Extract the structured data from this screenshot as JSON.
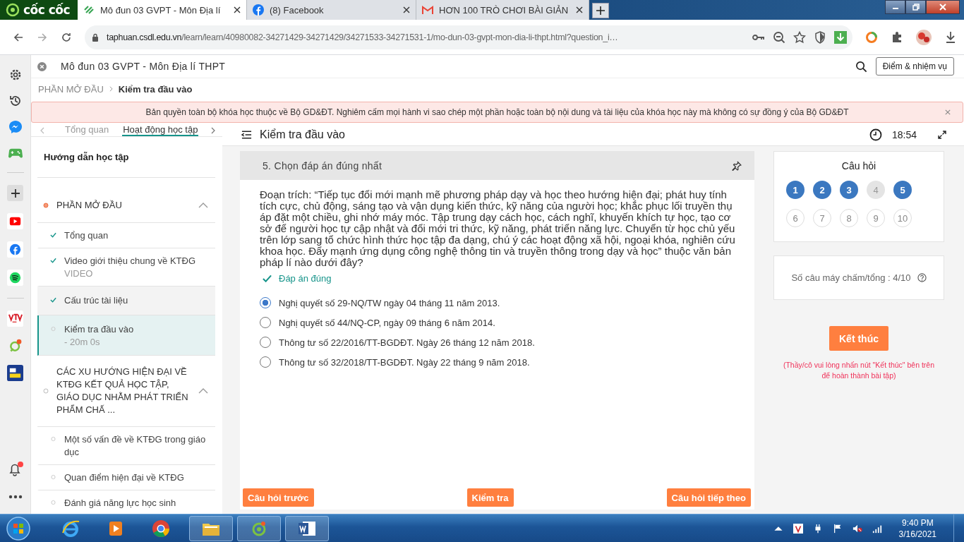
{
  "browser": {
    "logo": "cốc cốc",
    "tabs": [
      {
        "kind": "course",
        "title": "Mô đun 03 GVPT - Môn Địa lí",
        "selected": true
      },
      {
        "kind": "facebook",
        "title": "(8) Facebook",
        "selected": false
      },
      {
        "kind": "gmail",
        "title": "HƠN 100 TRÒ CHƠI BÀI GIẢN",
        "selected": false
      }
    ],
    "address_host": "taphuan.csdl.edu.vn",
    "address_path": "/learn/learn/40980082-34271429-34271429/34271533-34271531-1/mo-dun-03-gvpt-mon-dia-li-thpt.html?question_i…"
  },
  "course": {
    "title": "Mô đun 03 GVPT - Môn Địa lí THPT",
    "score_button": "Điểm & nhiệm vụ",
    "breadcrumb": [
      {
        "label": "PHẦN MỞ ĐẦU",
        "current": false
      },
      {
        "label": "Kiểm tra đầu vào",
        "current": true
      }
    ],
    "notice": "Bản quyền toàn bộ khóa học thuộc về Bộ GD&ĐT. Nghiêm cấm mọi hành vi sao chép một phần hoặc toàn bộ nội dung và tài liệu của khóa học này mà không có sự đồng ý của Bộ GD&ĐT"
  },
  "sidebar": {
    "tabs": [
      {
        "label": "Tổng quan",
        "selected": false
      },
      {
        "label": "Hoạt động học tập",
        "selected": true
      }
    ],
    "guide": "Hướng dẫn học tập",
    "sections": [
      {
        "title": "PHẦN MỞ ĐẦU",
        "current": true,
        "expanded": true,
        "items": [
          {
            "title": "Tổng quan",
            "done": true,
            "selected": false,
            "highlighted": false
          },
          {
            "title": "Video giới thiệu chung về KTĐG",
            "subtitle": "VIDEO",
            "done": true,
            "selected": false,
            "highlighted": false
          },
          {
            "title": "Cấu trúc tài liệu",
            "done": true,
            "selected": false,
            "highlighted": true
          },
          {
            "title": "Kiểm tra đầu vào",
            "subtitle": "- 20m 0s",
            "done": false,
            "selected": true,
            "highlighted": false
          }
        ]
      },
      {
        "title": "CÁC XU HƯỚNG HIỆN ĐẠI VỀ KTĐG KẾT QUẢ HỌC TẬP, GIÁO DỤC NHẰM PHÁT TRIỂN PHẨM CHẤ ...",
        "current": false,
        "expanded": true,
        "items": [
          {
            "title": "Một số vấn đề về KTĐG trong giáo dục",
            "done": false,
            "selected": false,
            "highlighted": false
          },
          {
            "title": "Quan điểm hiện đại về KTĐG",
            "done": false,
            "selected": false,
            "highlighted": false
          },
          {
            "title": "Đánh giá năng lực học sinh",
            "done": false,
            "selected": false,
            "highlighted": false
          }
        ]
      }
    ]
  },
  "lesson": {
    "title": "Kiểm tra đầu vào",
    "timer": "18:54"
  },
  "question": {
    "heading": "5. Chọn đáp án đúng nhất",
    "text": "Đoạn trích: “Tiếp tục đổi mới mạnh mẽ phương pháp dạy và học theo hướng hiện đại; phát huy tính tích cực, chủ động, sáng tạo và vận dụng kiến thức, kỹ năng của người học; khắc phục lối truyền thụ áp đặt một chiều, ghi nhớ máy móc. Tập trung dạy cách học, cách nghĩ, khuyến khích tự học, tạo cơ sở để người học tự cập nhật và đổi mới tri thức, kỹ năng, phát triển năng lực. Chuyển từ học chủ yếu trên lớp sang tổ chức hình thức học tập đa dạng, chú ý các hoạt động xã hội, ngoại khóa, nghiên cứu khoa học. Đẩy mạnh ứng dụng công nghệ thông tin và truyền thông trong dạy và học” thuộc văn bản pháp lí nào dưới đây?",
    "feedback": "Đáp án đúng",
    "options": [
      {
        "label": "Nghị quyết số 29-NQ/TW ngày 04 tháng 11 năm 2013.",
        "selected": true
      },
      {
        "label": "Nghị quyết số 44/NQ-CP, ngày 09 tháng 6 năm 2014.",
        "selected": false
      },
      {
        "label": "Thông tư số 22/2016/TT-BGDĐT. Ngày 26 tháng 12 năm 2018.",
        "selected": false
      },
      {
        "label": "Thông tư số 32/2018/TT-BGDĐT. Ngày 22 tháng 9 năm 2018.",
        "selected": false
      }
    ],
    "prev_button": "Câu hỏi trước",
    "check_button": "Kiểm tra",
    "next_button": "Câu hỏi tiếp theo"
  },
  "palette": {
    "title": "Câu hỏi",
    "questions": [
      {
        "label": "1",
        "answered": true,
        "visited": true
      },
      {
        "label": "2",
        "answered": true,
        "visited": true
      },
      {
        "label": "3",
        "answered": true,
        "visited": true
      },
      {
        "label": "4",
        "answered": false,
        "visited": true
      },
      {
        "label": "5",
        "answered": true,
        "visited": true
      },
      {
        "label": "6",
        "answered": false,
        "visited": false
      },
      {
        "label": "7",
        "answered": false,
        "visited": false
      },
      {
        "label": "8",
        "answered": false,
        "visited": false
      },
      {
        "label": "9",
        "answered": false,
        "visited": false
      },
      {
        "label": "10",
        "answered": false,
        "visited": false
      }
    ]
  },
  "stats": "Số câu máy chấm/tổng : 4/10",
  "finish_button": "Kết thúc",
  "finish_note": "(Thầy/cô vui lòng nhấn nút \"Kết thúc\" bên trên để hoàn thành bài tập)",
  "taskbar": {
    "time": "9:40 PM",
    "date": "3/16/2021"
  }
}
